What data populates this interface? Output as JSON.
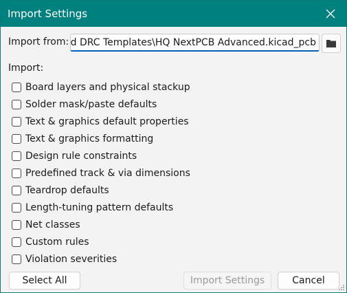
{
  "window": {
    "title": "Import Settings",
    "close_icon": "close-icon"
  },
  "import_from": {
    "label": "Import from:",
    "path_value": "ad DRC Templates\\HQ NextPCB Advanced.kicad_pcb",
    "browse_icon": "folder-icon"
  },
  "import": {
    "label": "Import:",
    "items": [
      {
        "label": "Board layers and physical stackup",
        "checked": false
      },
      {
        "label": "Solder mask/paste defaults",
        "checked": false
      },
      {
        "label": "Text & graphics default properties",
        "checked": false
      },
      {
        "label": "Text & graphics formatting",
        "checked": false
      },
      {
        "label": "Design rule constraints",
        "checked": false
      },
      {
        "label": "Predefined track & via dimensions",
        "checked": false
      },
      {
        "label": "Teardrop defaults",
        "checked": false
      },
      {
        "label": "Length-tuning pattern defaults",
        "checked": false
      },
      {
        "label": "Net classes",
        "checked": false
      },
      {
        "label": "Custom rules",
        "checked": false
      },
      {
        "label": "Violation severities",
        "checked": false
      }
    ]
  },
  "buttons": {
    "select_all": "Select All",
    "import_settings": "Import Settings",
    "import_settings_enabled": false,
    "cancel": "Cancel"
  },
  "colors": {
    "titlebar": "#00807f",
    "focus_underline": "#005fb8"
  }
}
